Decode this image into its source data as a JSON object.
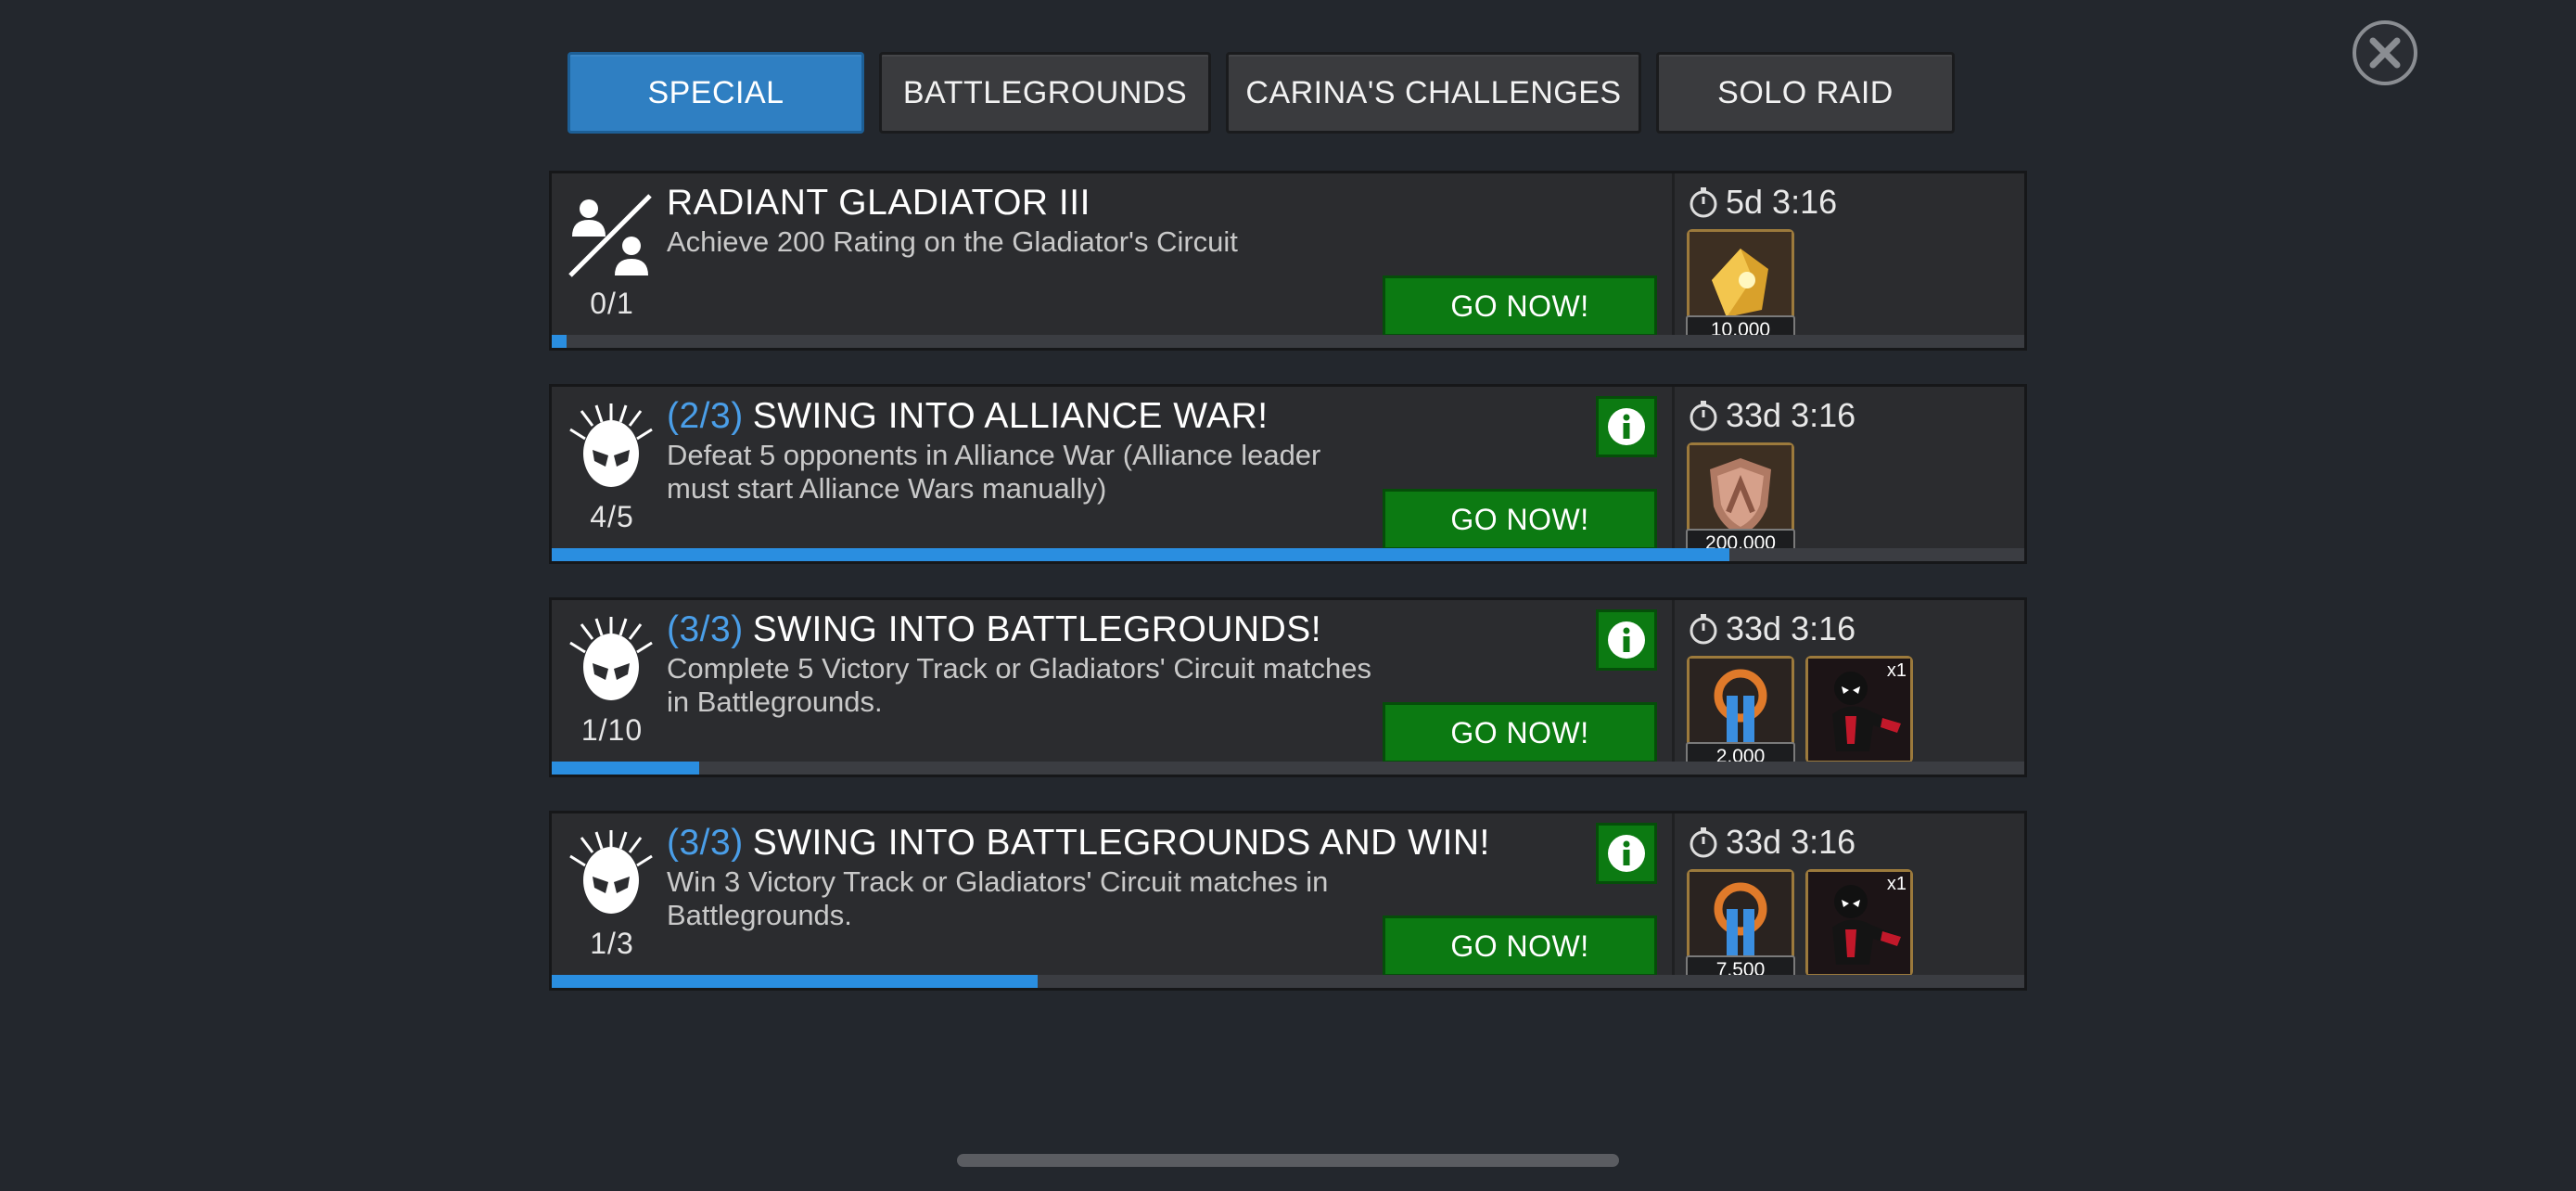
{
  "tabs": [
    {
      "label": "SPECIAL",
      "active": true
    },
    {
      "label": "BATTLEGROUNDS",
      "active": false
    },
    {
      "label": "CARINA'S CHALLENGES",
      "active": false
    },
    {
      "label": "SOLO RAID",
      "active": false
    }
  ],
  "close_icon": "close-icon",
  "colors": {
    "background": "#23272d",
    "tab_active": "#2f7fc2",
    "go_button": "#0c7a12",
    "stage_text": "#4a9ee8",
    "progress_fill": "#2a8ee0"
  },
  "quests": [
    {
      "icon": "gladiator-icon",
      "stage": "",
      "title": "RADIANT GLADIATOR III",
      "description": "Achieve 200 Rating on the Gladiator's Circuit",
      "count": "0/1",
      "progress": 0.01,
      "timer": "5d 3:16",
      "button": "GO NOW!",
      "has_info": false,
      "rewards": [
        {
          "icon": "gold-crystal-icon",
          "amount": "10,000",
          "multiplier": ""
        }
      ]
    },
    {
      "icon": "spider-mask-icon",
      "stage": "(2/3)",
      "title": "SWING INTO ALLIANCE WAR!",
      "description": "Defeat 5 opponents in Alliance War (Alliance leader must start Alliance Wars manually)",
      "count": "4/5",
      "progress": 0.8,
      "timer": "33d 3:16",
      "button": "GO NOW!",
      "has_info": true,
      "rewards": [
        {
          "icon": "alliance-shield-icon",
          "amount": "200,000",
          "multiplier": ""
        }
      ]
    },
    {
      "icon": "spider-mask-icon",
      "stage": "(3/3)",
      "title": "SWING INTO BATTLEGROUNDS!",
      "description": "Complete 5 Victory Track or Gladiators' Circuit matches in Battlegrounds.",
      "count": "1/10",
      "progress": 0.1,
      "timer": "33d 3:16",
      "button": "GO NOW!",
      "has_info": true,
      "rewards": [
        {
          "icon": "battlegrounds-token-icon",
          "amount": "2,000",
          "multiplier": ""
        },
        {
          "icon": "spider-hero-portrait-icon",
          "amount": "",
          "multiplier": "x1"
        }
      ]
    },
    {
      "icon": "spider-mask-icon",
      "stage": "(3/3)",
      "title": "SWING INTO BATTLEGROUNDS AND WIN!",
      "description": "Win 3 Victory Track or Gladiators' Circuit matches in Battlegrounds.",
      "count": "1/3",
      "progress": 0.33,
      "timer": "33d 3:16",
      "button": "GO NOW!",
      "has_info": true,
      "rewards": [
        {
          "icon": "battlegrounds-token-icon",
          "amount": "7,500",
          "multiplier": ""
        },
        {
          "icon": "spider-hero-portrait-icon",
          "amount": "",
          "multiplier": "x1"
        }
      ]
    }
  ]
}
